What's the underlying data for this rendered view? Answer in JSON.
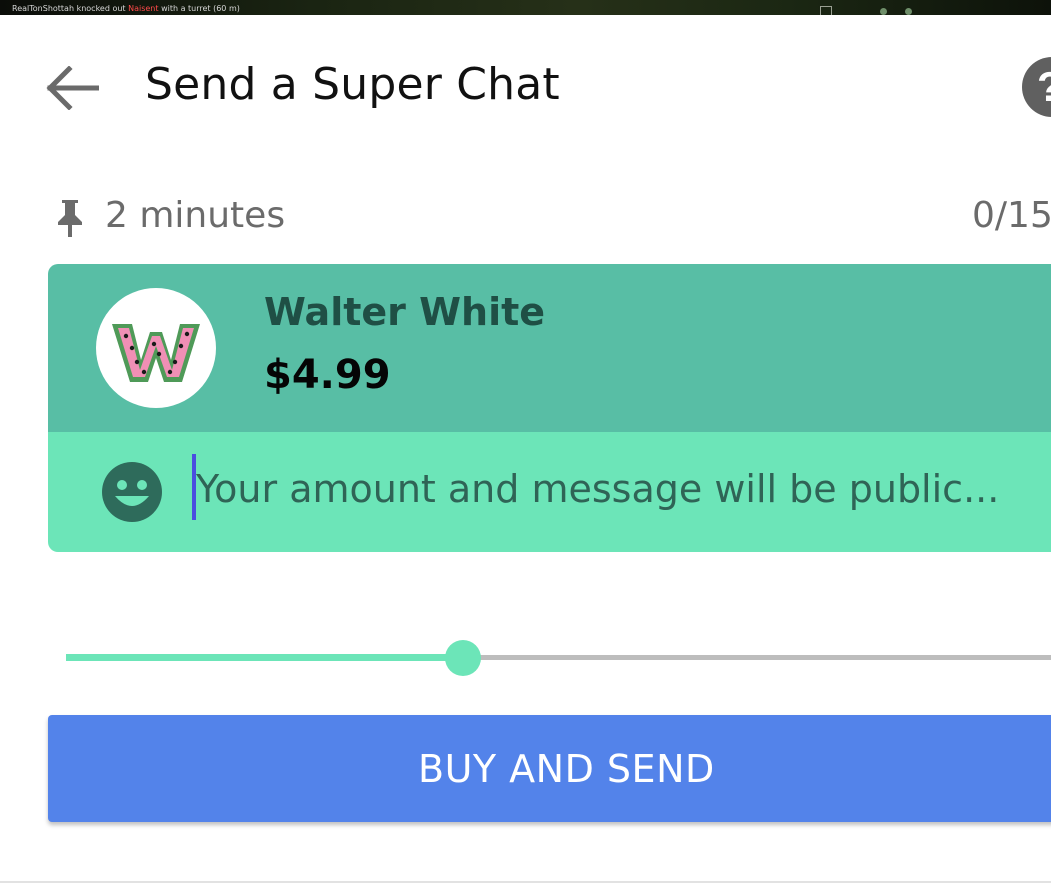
{
  "video": {
    "killfeed_prefix": "RealTonShottah knocked out",
    "killfeed_victim": "Naisent",
    "killfeed_suffix": "with a turret (60 m)"
  },
  "header": {
    "back_icon": "arrow-left-icon",
    "title": "Send a Super Chat",
    "help_icon": "help-circle-icon",
    "help_glyph": "?"
  },
  "meta": {
    "pin_icon": "pin-icon",
    "duration": "2 minutes",
    "counter": "0/15"
  },
  "card": {
    "avatar_icon": "watermelon-w-avatar",
    "name": "Walter White",
    "amount": "$4.99",
    "emoji_icon": "smiley-face-icon",
    "message_value": "",
    "message_placeholder": "Your amount and message will be public..."
  },
  "slider": {
    "position_fraction": 0.39
  },
  "actions": {
    "buy_label": "BUY AND SEND"
  },
  "colors": {
    "card_header": "#58bea5",
    "card_body": "#6ce5b8",
    "button": "#5383ea",
    "caret": "#4a4ee0"
  }
}
